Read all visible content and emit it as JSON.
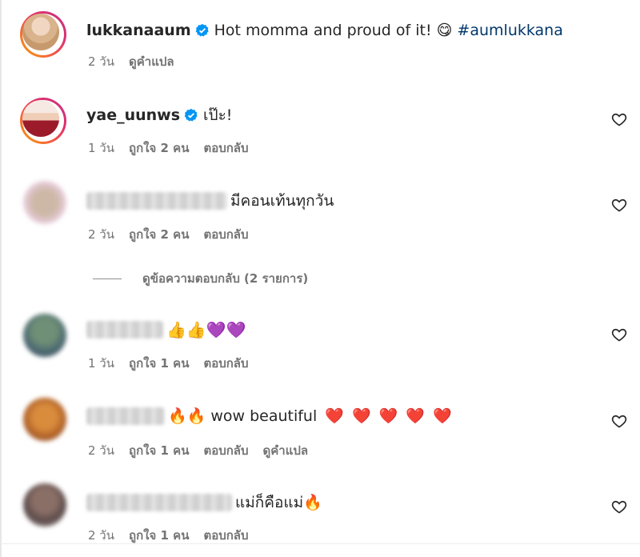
{
  "comments": [
    {
      "username": "lukkanaaum",
      "text": "Hot momma and proud of it! 😋",
      "hashtag": "#aumlukkana",
      "time": "2 วัน",
      "translate": "ดูคำแปล"
    },
    {
      "username": "yae_uunws",
      "text": "เป๊ะ!",
      "time": "1 วัน",
      "likes": "ถูกใจ 2 คน",
      "reply": "ตอบกลับ"
    },
    {
      "text": "มีคอนเท้นทุกวัน",
      "time": "2 วัน",
      "likes": "ถูกใจ 2 คน",
      "reply": "ตอบกลับ",
      "view_replies": "ดูข้อความตอบกลับ (2 รายการ)"
    },
    {
      "text_emojis": "👍👍💜💜",
      "time": "1 วัน",
      "likes": "ถูกใจ 1 คน",
      "reply": "ตอบกลับ"
    },
    {
      "text_pre": "🔥🔥",
      "text": "wow beautiful",
      "text_post": "❤️ ❤️ ❤️ ❤️ ❤️",
      "time": "2 วัน",
      "likes": "ถูกใจ 1 คน",
      "reply": "ตอบกลับ",
      "translate": "ดูคำแปล"
    },
    {
      "text": "แม่ก็คือแม่🔥",
      "time": "2 วัน",
      "likes": "ถูกใจ 1 คน",
      "reply": "ตอบกลับ"
    }
  ],
  "colors": {
    "username": "#262626",
    "meta": "#737373",
    "hashtag": "#00376b",
    "verified": "#0095f6"
  },
  "icons": [
    "verified-badge-icon",
    "heart-icon"
  ]
}
